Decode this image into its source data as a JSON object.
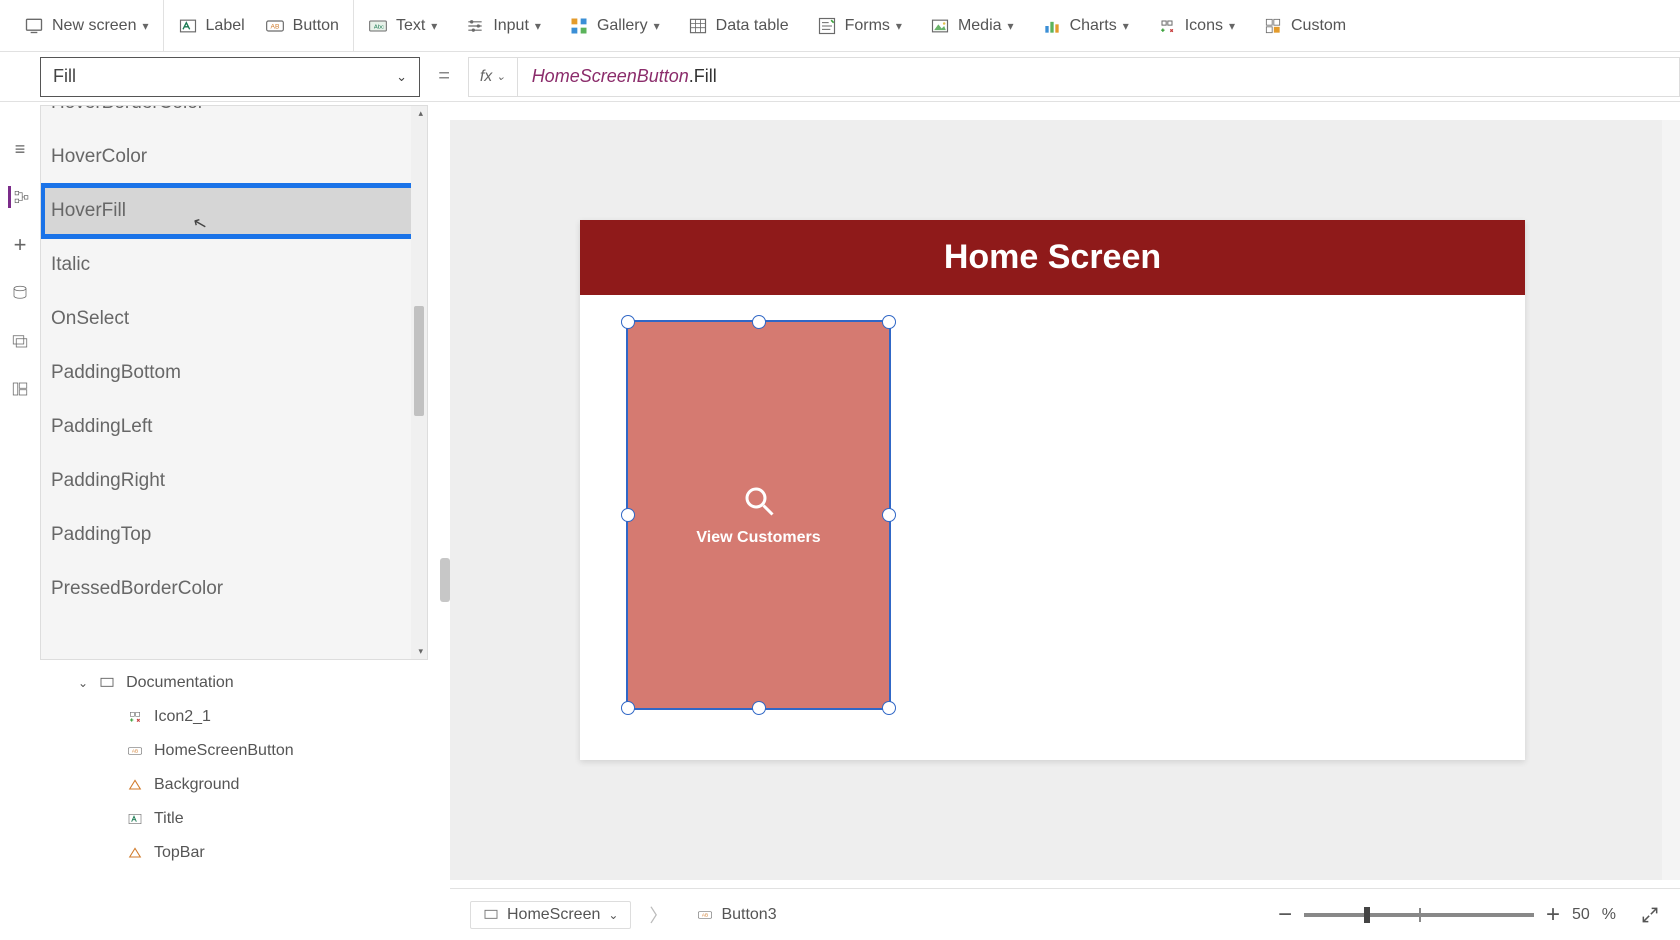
{
  "ribbon": {
    "new_screen": "New screen",
    "label": "Label",
    "button": "Button",
    "text": "Text",
    "input": "Input",
    "gallery": "Gallery",
    "data_table": "Data table",
    "forms": "Forms",
    "media": "Media",
    "charts": "Charts",
    "icons": "Icons",
    "custom": "Custom"
  },
  "property_selector": {
    "value": "Fill"
  },
  "formula": {
    "control": "HomeScreenButton",
    "prop": ".Fill"
  },
  "property_dropdown": {
    "items": [
      "HoverBorderColor",
      "HoverColor",
      "HoverFill",
      "Italic",
      "OnSelect",
      "PaddingBottom",
      "PaddingLeft",
      "PaddingRight",
      "PaddingTop",
      "PressedBorderColor"
    ],
    "highlighted_index": 2
  },
  "tree": {
    "parent": "Documentation",
    "children": [
      "Icon2_1",
      "HomeScreenButton",
      "Background",
      "Title",
      "TopBar"
    ]
  },
  "canvas": {
    "header_title": "Home Screen",
    "button_label": "View Customers"
  },
  "breadcrumb": {
    "screen": "HomeScreen",
    "control": "Button3"
  },
  "zoom": {
    "value": "50",
    "unit": "%"
  }
}
